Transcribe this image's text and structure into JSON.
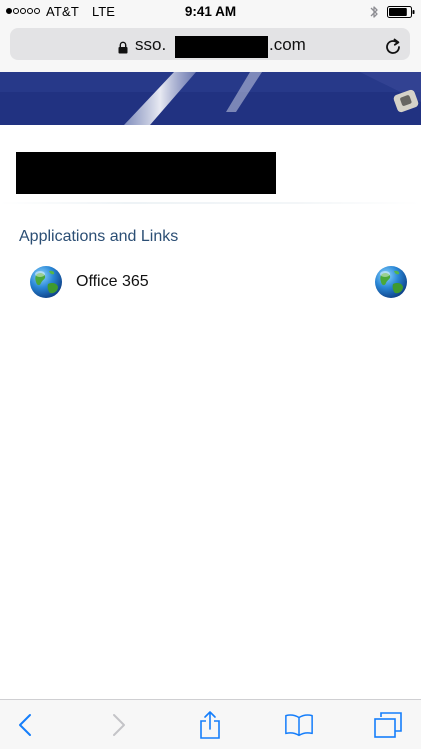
{
  "status_bar": {
    "signal_dots_filled": 1,
    "signal_dots_total": 5,
    "carrier": "AT&T",
    "network": "LTE",
    "time": "9:41 AM",
    "bluetooth_icon": "bluetooth-icon",
    "battery_icon": "battery-icon",
    "battery_level": 0.85
  },
  "browser": {
    "lock_icon": "lock-icon",
    "url_prefix": "sso.",
    "url_suffix": ".com",
    "reload_icon": "reload-icon"
  },
  "page": {
    "section_heading": "Applications and Links",
    "apps": [
      {
        "label": "Office 365",
        "icon": "globe-icon"
      }
    ]
  },
  "toolbar": {
    "items": [
      {
        "icon": "back-icon",
        "enabled": true
      },
      {
        "icon": "forward-icon",
        "enabled": false
      },
      {
        "icon": "share-icon",
        "enabled": true
      },
      {
        "icon": "bookmarks-icon",
        "enabled": true
      },
      {
        "icon": "tabs-icon",
        "enabled": true
      }
    ]
  },
  "colors": {
    "ios_blue": "#157efb",
    "disabled_gray": "#c4c4c8",
    "heading_blue": "#2b4e74",
    "banner_blue": "#1e2f7a"
  }
}
